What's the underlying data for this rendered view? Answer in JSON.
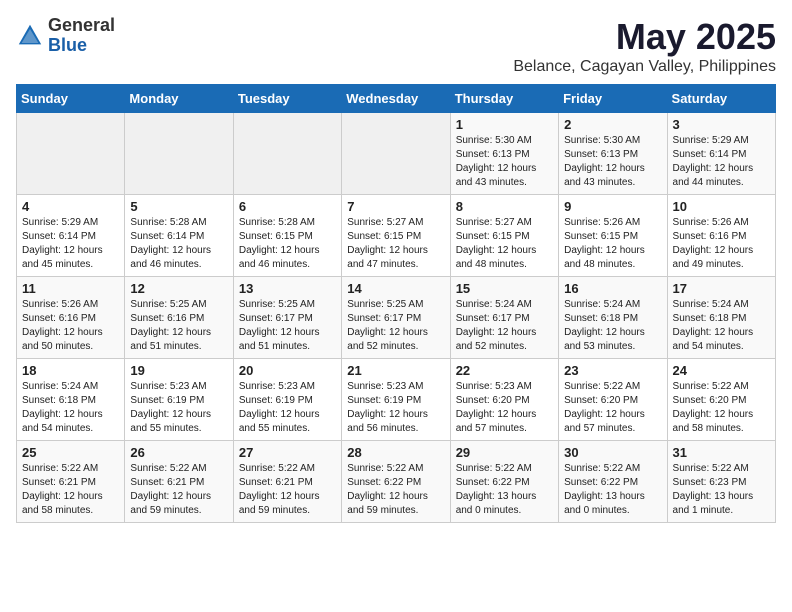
{
  "header": {
    "logo_general": "General",
    "logo_blue": "Blue",
    "month": "May 2025",
    "location": "Belance, Cagayan Valley, Philippines"
  },
  "days_of_week": [
    "Sunday",
    "Monday",
    "Tuesday",
    "Wednesday",
    "Thursday",
    "Friday",
    "Saturday"
  ],
  "weeks": [
    [
      {
        "day": "",
        "info": ""
      },
      {
        "day": "",
        "info": ""
      },
      {
        "day": "",
        "info": ""
      },
      {
        "day": "",
        "info": ""
      },
      {
        "day": "1",
        "info": "Sunrise: 5:30 AM\nSunset: 6:13 PM\nDaylight: 12 hours\nand 43 minutes."
      },
      {
        "day": "2",
        "info": "Sunrise: 5:30 AM\nSunset: 6:13 PM\nDaylight: 12 hours\nand 43 minutes."
      },
      {
        "day": "3",
        "info": "Sunrise: 5:29 AM\nSunset: 6:14 PM\nDaylight: 12 hours\nand 44 minutes."
      }
    ],
    [
      {
        "day": "4",
        "info": "Sunrise: 5:29 AM\nSunset: 6:14 PM\nDaylight: 12 hours\nand 45 minutes."
      },
      {
        "day": "5",
        "info": "Sunrise: 5:28 AM\nSunset: 6:14 PM\nDaylight: 12 hours\nand 46 minutes."
      },
      {
        "day": "6",
        "info": "Sunrise: 5:28 AM\nSunset: 6:15 PM\nDaylight: 12 hours\nand 46 minutes."
      },
      {
        "day": "7",
        "info": "Sunrise: 5:27 AM\nSunset: 6:15 PM\nDaylight: 12 hours\nand 47 minutes."
      },
      {
        "day": "8",
        "info": "Sunrise: 5:27 AM\nSunset: 6:15 PM\nDaylight: 12 hours\nand 48 minutes."
      },
      {
        "day": "9",
        "info": "Sunrise: 5:26 AM\nSunset: 6:15 PM\nDaylight: 12 hours\nand 48 minutes."
      },
      {
        "day": "10",
        "info": "Sunrise: 5:26 AM\nSunset: 6:16 PM\nDaylight: 12 hours\nand 49 minutes."
      }
    ],
    [
      {
        "day": "11",
        "info": "Sunrise: 5:26 AM\nSunset: 6:16 PM\nDaylight: 12 hours\nand 50 minutes."
      },
      {
        "day": "12",
        "info": "Sunrise: 5:25 AM\nSunset: 6:16 PM\nDaylight: 12 hours\nand 51 minutes."
      },
      {
        "day": "13",
        "info": "Sunrise: 5:25 AM\nSunset: 6:17 PM\nDaylight: 12 hours\nand 51 minutes."
      },
      {
        "day": "14",
        "info": "Sunrise: 5:25 AM\nSunset: 6:17 PM\nDaylight: 12 hours\nand 52 minutes."
      },
      {
        "day": "15",
        "info": "Sunrise: 5:24 AM\nSunset: 6:17 PM\nDaylight: 12 hours\nand 52 minutes."
      },
      {
        "day": "16",
        "info": "Sunrise: 5:24 AM\nSunset: 6:18 PM\nDaylight: 12 hours\nand 53 minutes."
      },
      {
        "day": "17",
        "info": "Sunrise: 5:24 AM\nSunset: 6:18 PM\nDaylight: 12 hours\nand 54 minutes."
      }
    ],
    [
      {
        "day": "18",
        "info": "Sunrise: 5:24 AM\nSunset: 6:18 PM\nDaylight: 12 hours\nand 54 minutes."
      },
      {
        "day": "19",
        "info": "Sunrise: 5:23 AM\nSunset: 6:19 PM\nDaylight: 12 hours\nand 55 minutes."
      },
      {
        "day": "20",
        "info": "Sunrise: 5:23 AM\nSunset: 6:19 PM\nDaylight: 12 hours\nand 55 minutes."
      },
      {
        "day": "21",
        "info": "Sunrise: 5:23 AM\nSunset: 6:19 PM\nDaylight: 12 hours\nand 56 minutes."
      },
      {
        "day": "22",
        "info": "Sunrise: 5:23 AM\nSunset: 6:20 PM\nDaylight: 12 hours\nand 57 minutes."
      },
      {
        "day": "23",
        "info": "Sunrise: 5:22 AM\nSunset: 6:20 PM\nDaylight: 12 hours\nand 57 minutes."
      },
      {
        "day": "24",
        "info": "Sunrise: 5:22 AM\nSunset: 6:20 PM\nDaylight: 12 hours\nand 58 minutes."
      }
    ],
    [
      {
        "day": "25",
        "info": "Sunrise: 5:22 AM\nSunset: 6:21 PM\nDaylight: 12 hours\nand 58 minutes."
      },
      {
        "day": "26",
        "info": "Sunrise: 5:22 AM\nSunset: 6:21 PM\nDaylight: 12 hours\nand 59 minutes."
      },
      {
        "day": "27",
        "info": "Sunrise: 5:22 AM\nSunset: 6:21 PM\nDaylight: 12 hours\nand 59 minutes."
      },
      {
        "day": "28",
        "info": "Sunrise: 5:22 AM\nSunset: 6:22 PM\nDaylight: 12 hours\nand 59 minutes."
      },
      {
        "day": "29",
        "info": "Sunrise: 5:22 AM\nSunset: 6:22 PM\nDaylight: 13 hours\nand 0 minutes."
      },
      {
        "day": "30",
        "info": "Sunrise: 5:22 AM\nSunset: 6:22 PM\nDaylight: 13 hours\nand 0 minutes."
      },
      {
        "day": "31",
        "info": "Sunrise: 5:22 AM\nSunset: 6:23 PM\nDaylight: 13 hours\nand 1 minute."
      }
    ]
  ]
}
